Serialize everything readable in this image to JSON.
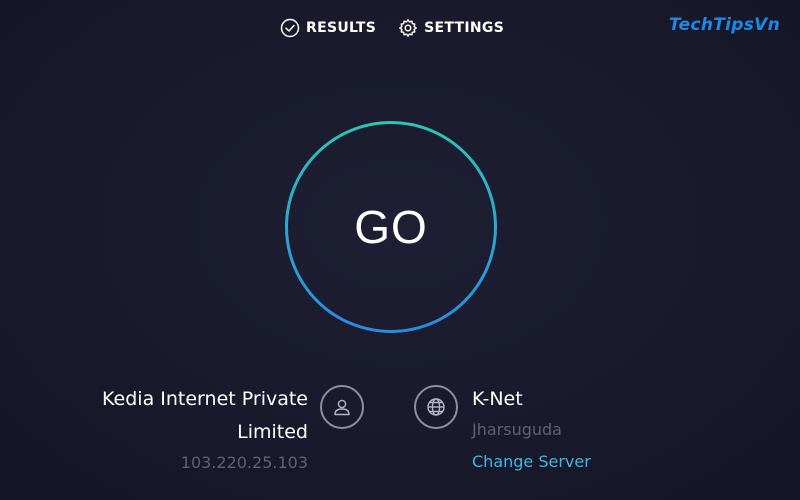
{
  "nav": {
    "results_label": "RESULTS",
    "settings_label": "SETTINGS",
    "results_icon": "check-circle-icon",
    "settings_icon": "gear-icon"
  },
  "brand": {
    "watermark": "TechTipsVn",
    "color": "#1e88e5"
  },
  "go_button": {
    "label": "GO",
    "ring_colors": [
      "#2ec4b6",
      "#2a8be0"
    ]
  },
  "isp": {
    "name": "Kedia Internet Private Limited",
    "ip": "103.220.25.103",
    "icon": "user-icon"
  },
  "server": {
    "name": "K-Net",
    "location": "Jharsuguda",
    "change_label": "Change Server",
    "icon": "globe-icon",
    "link_color": "#3db7e8"
  }
}
